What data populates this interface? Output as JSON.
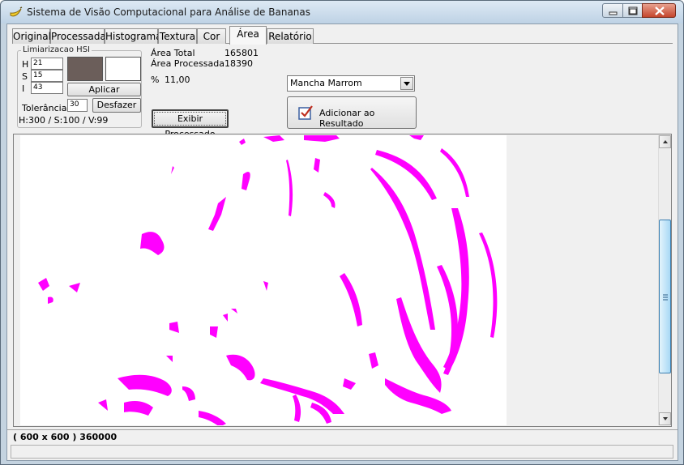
{
  "window": {
    "title": "Sistema de Visão Computacional para Análise de Bananas",
    "icon": "banana-icon",
    "controls": [
      "minimize-icon",
      "maximize-icon",
      "close-icon"
    ]
  },
  "tabs": [
    {
      "label": "Original"
    },
    {
      "label": "Processada"
    },
    {
      "label": "Histograma"
    },
    {
      "label": "Textura"
    },
    {
      "label": "Cor"
    },
    {
      "label": "Área",
      "active": true
    },
    {
      "label": "Relatório"
    }
  ],
  "threshold": {
    "group_title": "Limiarizacao HSI",
    "h_label": "H",
    "h_value": "21",
    "s_label": "S",
    "s_value": "15",
    "i_label": "I",
    "i_value": "43",
    "color_swatch": "#6b5e5a",
    "second_swatch": "#ffffff",
    "apply_label": "Aplicar",
    "tolerance_label": "Tolerância",
    "tolerance_value": "30",
    "undo_label": "Desfazer",
    "hsv_readout": "H:300 / S:100 / V:99"
  },
  "area": {
    "total_label": "Área Total",
    "total_value": "165801",
    "processed_label": "Área Processada",
    "processed_value": "18390",
    "percent_label": "%",
    "percent_value": "11,00",
    "show_processed_label": "Exibir Processado"
  },
  "result": {
    "class_select_value": "Mancha Marrom",
    "add_button_label": "Adicionar ao Resultado",
    "add_button_icon": "checkbox-add-icon"
  },
  "image": {
    "mask_color": "#ff00ff"
  },
  "status": {
    "dimensions": "( 600 x 600 ) 360000"
  }
}
